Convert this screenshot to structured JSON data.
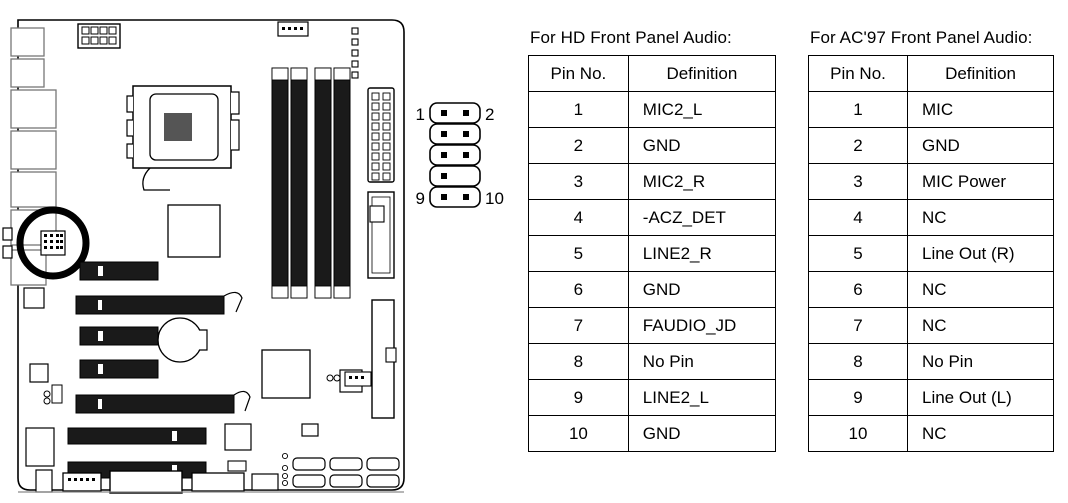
{
  "hd_table": {
    "caption": "For HD  Front Panel Audio:",
    "columns": [
      "Pin No.",
      "Definition"
    ],
    "rows": [
      {
        "pin": "1",
        "definition": "MIC2_L"
      },
      {
        "pin": "2",
        "definition": "GND"
      },
      {
        "pin": "3",
        "definition": "MIC2_R"
      },
      {
        "pin": "4",
        "definition": "-ACZ_DET"
      },
      {
        "pin": "5",
        "definition": "LINE2_R"
      },
      {
        "pin": "6",
        "definition": "GND"
      },
      {
        "pin": "7",
        "definition": "FAUDIO_JD"
      },
      {
        "pin": "8",
        "definition": "No Pin"
      },
      {
        "pin": "9",
        "definition": "LINE2_L"
      },
      {
        "pin": "10",
        "definition": "GND"
      }
    ]
  },
  "ac97_table": {
    "caption": "For  AC'97 Front Panel Audio:",
    "columns": [
      "Pin No.",
      "Definition"
    ],
    "rows": [
      {
        "pin": "1",
        "definition": "MIC"
      },
      {
        "pin": "2",
        "definition": "GND"
      },
      {
        "pin": "3",
        "definition": "MIC Power"
      },
      {
        "pin": "4",
        "definition": "NC"
      },
      {
        "pin": "5",
        "definition": "Line Out (R)"
      },
      {
        "pin": "6",
        "definition": "NC"
      },
      {
        "pin": "7",
        "definition": "NC"
      },
      {
        "pin": "8",
        "definition": "No Pin"
      },
      {
        "pin": "9",
        "definition": "Line Out (L)"
      },
      {
        "pin": "10",
        "definition": "NC"
      }
    ]
  },
  "connector": {
    "label_top_left": "1",
    "label_top_right": "2",
    "label_bottom_left": "9",
    "label_bottom_right": "10",
    "rows": 5,
    "missing_pin_row_index": 3,
    "missing_pin_side": "right"
  },
  "colors": {
    "outline": "#000000",
    "background": "#ffffff",
    "slot_fill": "#1a1a1a",
    "highlight_ring": "#000000"
  }
}
